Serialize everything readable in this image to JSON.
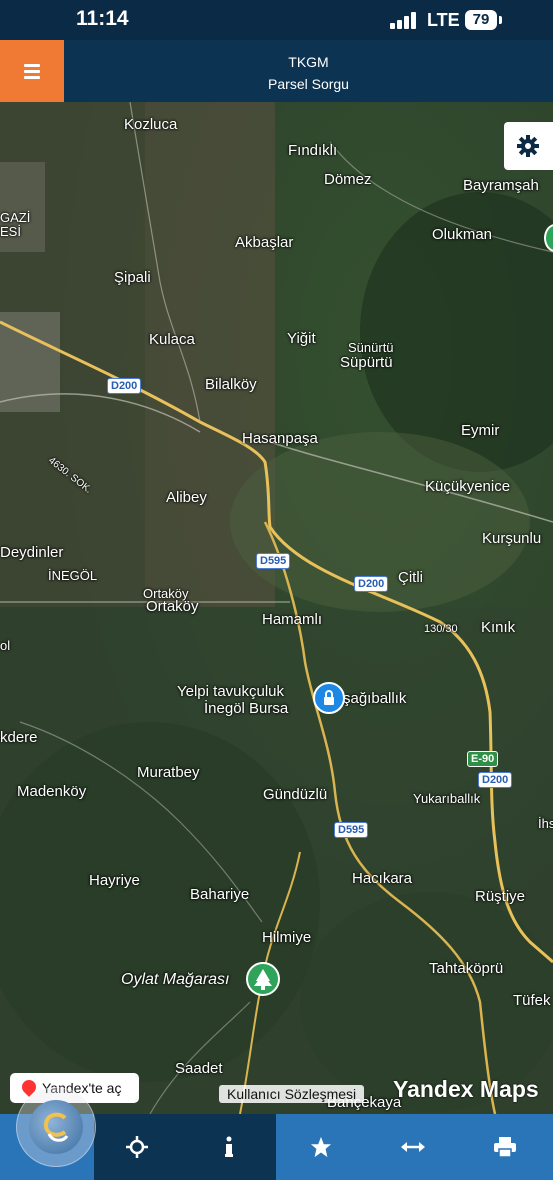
{
  "status_bar": {
    "time": "11:14",
    "network": "LTE",
    "battery": "79"
  },
  "header": {
    "title": "TKGM",
    "subtitle": "Parsel Sorgu"
  },
  "map": {
    "places": {
      "kozluca": "Kozluca",
      "findikli": "Fındıklı",
      "domez": "Dömez",
      "bayramsah": "Bayramşah",
      "gazi": "GAZİ",
      "esi": "ESİ",
      "akbaslar": "Akbaşlar",
      "olukman": "Olukman",
      "sipali": "Şipali",
      "kulaca": "Kulaca",
      "yigit": "Yiğit",
      "sunurtu_a": "Sünürtü",
      "sunurtu_b": "Süpürtü",
      "bilalkoy": "Bilalköy",
      "hasanpasa": "Hasanpaşa",
      "eymir": "Eymir",
      "kucukyenice": "Küçükyenice",
      "alibey": "Alibey",
      "kursunlu": "Kurşunlu",
      "sok4630": "4630. SOK.",
      "deydinler": "Deydinler",
      "inegol": "İNEGÖL",
      "citli": "Çitli",
      "ortakoy_a": "Ortaköy",
      "ortakoy_b": "Ortaköy",
      "hamamli": "Hamamlı",
      "kinik": "Kınık",
      "speed": "130/30",
      "yelpi_line1": "Yelpi tavukçuluk",
      "yelpi_line2": "İnegöl Bursa",
      "asagiballik": "şağıballık",
      "kdere": "kdere",
      "muratbey": "Muratbey",
      "madenkoy": "Madenköy",
      "gunduzlu": "Gündüzlü",
      "yukariballik": "Yukarıballık",
      "hayriye": "Hayriye",
      "hacikara": "Hacıkara",
      "rustiye": "Rüştiye",
      "bahariye": "Bahariye",
      "hilmiye": "Hilmiye",
      "oylat": "Oylat Mağarası",
      "tahtakopru": "Tahtaköprü",
      "tufek": "Tüfek",
      "saadet": "Saadet",
      "bahcekaya": "Bahçekaya",
      "ihs": "İhs",
      "ol": "ol"
    },
    "roads": {
      "d200_a": "D200",
      "d200_b": "D200",
      "d200_c": "D200",
      "d595_a": "D595",
      "d595_b": "D595",
      "e90": "E-90"
    },
    "yandex_button": "Yandex'te aç",
    "terms_link": "Kullanıcı Sözleşmesi",
    "brand": "Yandex Maps"
  },
  "toolbar": {
    "items": [
      "logo",
      "locate-icon",
      "info-icon",
      "star-icon",
      "measure-icon",
      "print-icon"
    ]
  },
  "colors": {
    "header": "#0c3352",
    "menu": "#f07a33",
    "toolbar": "#2a74b8"
  }
}
